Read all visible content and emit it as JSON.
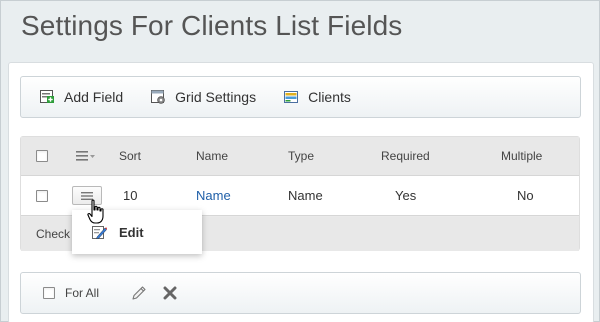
{
  "page": {
    "title": "Settings For Clients List Fields"
  },
  "toolbar": {
    "add_field": "Add Field",
    "grid_settings": "Grid Settings",
    "clients": "Clients"
  },
  "grid": {
    "columns": {
      "sort": "Sort",
      "name": "Name",
      "type": "Type",
      "required": "Required",
      "multiple": "Multiple"
    },
    "rows": [
      {
        "sort": "10",
        "name": "Name",
        "type": "Name",
        "required": "Yes",
        "multiple": "No"
      }
    ],
    "footer_text": "Check"
  },
  "context_menu": {
    "edit": "Edit"
  },
  "bottom_bar": {
    "for_all": "For All"
  },
  "colors": {
    "link": "#1f5fa8",
    "accent_green": "#2e9d3a"
  }
}
